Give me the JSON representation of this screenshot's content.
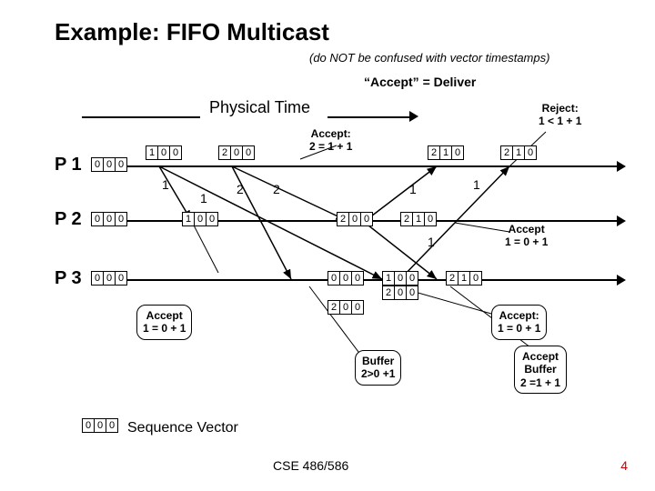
{
  "title": "Example: FIFO Multicast",
  "subtitle": "(do NOT be confused with vector timestamps)",
  "accept_deliver": "“Accept” = Deliver",
  "physical_time": "Physical Time",
  "processes": {
    "p1": "P 1",
    "p2": "P 2",
    "p3": "P 3"
  },
  "vectors": {
    "p1_init": [
      "0",
      "0",
      "0"
    ],
    "p1_a": [
      "1",
      "0",
      "0"
    ],
    "p1_b": [
      "2",
      "0",
      "0"
    ],
    "p1_c": [
      "2",
      "1",
      "0"
    ],
    "p1_d": [
      "2",
      "1",
      "0"
    ],
    "p2_init": [
      "0",
      "0",
      "0"
    ],
    "p2_a": [
      "1",
      "0",
      "0"
    ],
    "p2_b": [
      "2",
      "0",
      "0"
    ],
    "p2_c": [
      "2",
      "1",
      "0"
    ],
    "p3_init": [
      "0",
      "0",
      "0"
    ],
    "p3_a": [
      "0",
      "0",
      "0"
    ],
    "p3_b": [
      "1",
      "0",
      "0"
    ],
    "p3_c": [
      "2",
      "0",
      "0"
    ],
    "p3_d": [
      "2",
      "0",
      "0"
    ],
    "p3_e": [
      "2",
      "1",
      "0"
    ],
    "seq": [
      "0",
      "0",
      "0"
    ]
  },
  "msg_nums": {
    "m1a": "1",
    "m1b": "1",
    "m2a": "2",
    "m2b": "2",
    "m3a": "1",
    "m3b": "1",
    "m4": "1"
  },
  "annotations": {
    "accept_2": "Accept:\n2 = 1 + 1",
    "reject": "Reject:\n1 < 1 + 1",
    "accept_top_right": "Accept\n1 = 0 + 1",
    "accept_left": "Accept\n1 = 0 + 1",
    "accept_bottom": "Accept:\n1 = 0 + 1",
    "buffer": "Buffer\n2>0 +1",
    "accept_buffer": "Accept\nBuffer\n2 =1 + 1"
  },
  "seq_label": "Sequence Vector",
  "footer": "CSE 486/586",
  "page": "4"
}
